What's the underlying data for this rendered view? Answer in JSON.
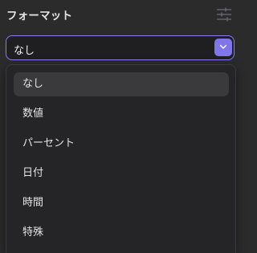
{
  "header": {
    "title": "フォーマット",
    "settings_icon": "sliders-icon"
  },
  "select": {
    "value": "なし",
    "chevron_icon": "chevron-down-icon",
    "accent_color": "#8b7cf6"
  },
  "dropdown": {
    "selected_index": 0,
    "options": [
      {
        "label": "なし"
      },
      {
        "label": "数値"
      },
      {
        "label": "パーセント"
      },
      {
        "label": "日付"
      },
      {
        "label": "時間"
      },
      {
        "label": "特殊"
      }
    ]
  }
}
